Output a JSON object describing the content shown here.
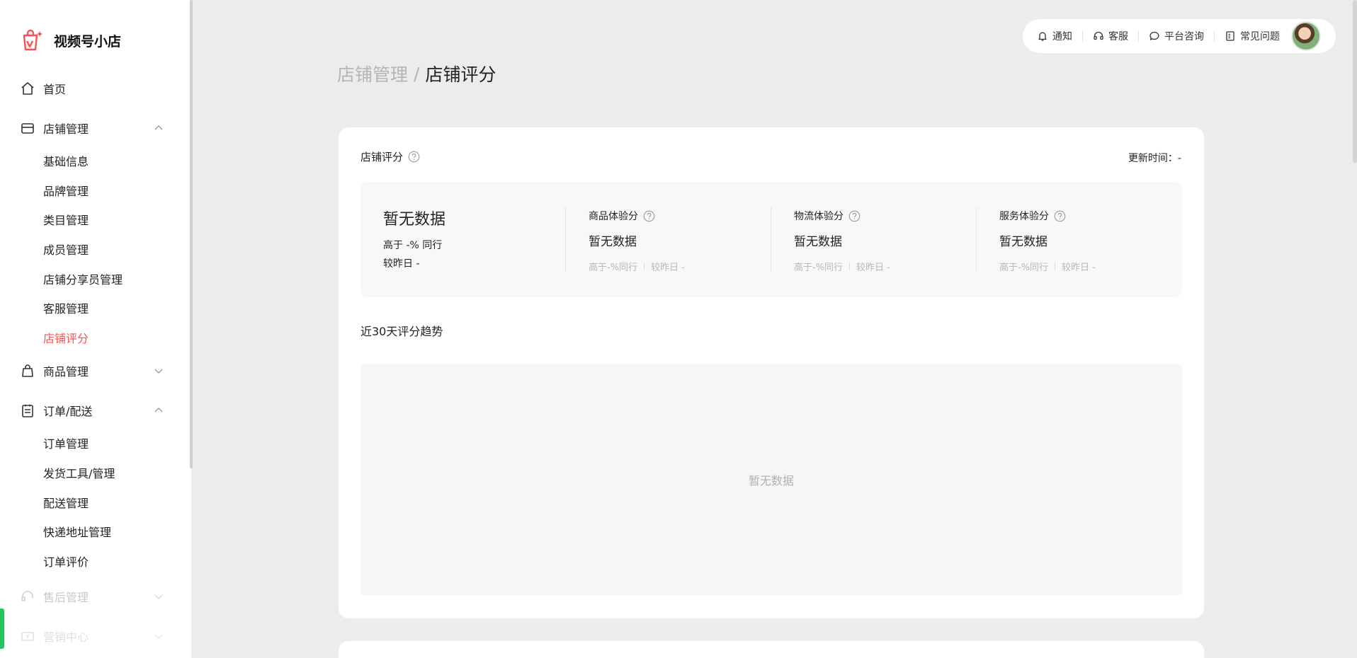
{
  "app": {
    "name": "视频号小店"
  },
  "sidebar": {
    "items": [
      {
        "label": "首页",
        "icon": "home-icon"
      },
      {
        "label": "店铺管理",
        "icon": "store-icon",
        "expanded": true,
        "children": [
          "基础信息",
          "品牌管理",
          "类目管理",
          "成员管理",
          "店铺分享员管理",
          "客服管理",
          "店铺评分"
        ],
        "active_child": "店铺评分"
      },
      {
        "label": "商品管理",
        "icon": "bag-icon",
        "expanded": false
      },
      {
        "label": "订单/配送",
        "icon": "clipboard-icon",
        "expanded": true,
        "children": [
          "订单管理",
          "发货工具/管理",
          "配送管理",
          "快递地址管理",
          "订单评价"
        ]
      },
      {
        "label": "售后管理",
        "icon": "headset-icon",
        "expanded": false
      },
      {
        "label": "营销中心",
        "icon": "ticket-icon",
        "expanded": false
      }
    ]
  },
  "toolbar": {
    "items": [
      {
        "label": "通知",
        "icon": "bell-icon"
      },
      {
        "label": "客服",
        "icon": "headset-icon"
      },
      {
        "label": "平台咨询",
        "icon": "chat-icon"
      },
      {
        "label": "常见问题",
        "icon": "document-icon"
      }
    ],
    "avatar": "avatar"
  },
  "breadcrumb": {
    "parent": "店铺管理",
    "separator": "/",
    "current": "店铺评分"
  },
  "score_card": {
    "title": "店铺评分",
    "update_time": "更新时间：-",
    "overall": {
      "value": "暂无数据",
      "peer_line": "高于 -% 同行",
      "compare_line": "较昨日 -"
    },
    "metrics": [
      {
        "label": "商品体验分",
        "value": "暂无数据",
        "peer": "高于-%同行",
        "compare": "较昨日 -"
      },
      {
        "label": "物流体验分",
        "value": "暂无数据",
        "peer": "高于-%同行",
        "compare": "较昨日 -"
      },
      {
        "label": "服务体验分",
        "value": "暂无数据",
        "peer": "高于-%同行",
        "compare": "较昨日 -"
      }
    ],
    "trend_title": "近30天评分趋势",
    "trend_empty": "暂无数据"
  },
  "colors": {
    "accent": "#fa5151",
    "background": "#ececec",
    "panel": "#f8f8f8",
    "muted_text": "#b7b7b7",
    "green_indicator": "#22c55e"
  }
}
